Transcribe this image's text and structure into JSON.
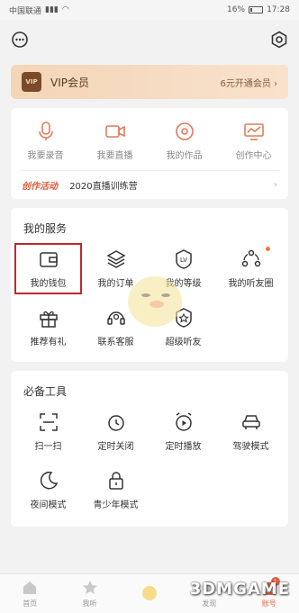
{
  "status_bar": {
    "carrier": "中国联通",
    "battery": "16%",
    "time": "17:28"
  },
  "vip": {
    "badge": "VIP",
    "label": "VIP会员",
    "action": "6元开通会员 ›"
  },
  "create": {
    "items": [
      {
        "label": "我要录音",
        "icon": "microphone-icon"
      },
      {
        "label": "我要直播",
        "icon": "video-camera-icon"
      },
      {
        "label": "我的作品",
        "icon": "disc-icon"
      },
      {
        "label": "创作中心",
        "icon": "chart-monitor-icon"
      }
    ],
    "activity_tag": "创作活动",
    "activity_text": "2020直播训练营",
    "activity_arrow": "›"
  },
  "services": {
    "title": "我的服务",
    "items": [
      {
        "label": "我的钱包",
        "icon": "wallet-icon"
      },
      {
        "label": "我的订单",
        "icon": "layers-icon"
      },
      {
        "label": "我的等级",
        "icon": "level-badge-icon"
      },
      {
        "label": "我的听友圈",
        "icon": "circle-people-icon"
      },
      {
        "label": "推荐有礼",
        "icon": "gift-icon"
      },
      {
        "label": "联系客服",
        "icon": "headset-icon"
      },
      {
        "label": "超级听友",
        "icon": "star-badge-icon"
      }
    ]
  },
  "tools": {
    "title": "必备工具",
    "items": [
      {
        "label": "扫一扫",
        "icon": "scan-icon"
      },
      {
        "label": "定时关闭",
        "icon": "clock-icon"
      },
      {
        "label": "定时播放",
        "icon": "alarm-play-icon"
      },
      {
        "label": "驾驶模式",
        "icon": "car-icon"
      },
      {
        "label": "夜间模式",
        "icon": "moon-icon"
      },
      {
        "label": "青少年模式",
        "icon": "lock-icon"
      }
    ]
  },
  "tabbar": {
    "items": [
      {
        "label": "首页"
      },
      {
        "label": "我听"
      },
      {
        "label": ""
      },
      {
        "label": "发现"
      },
      {
        "label": "账号"
      }
    ]
  },
  "watermark": "3DMGAME",
  "colors": {
    "accent": "#e05c3a",
    "vip_bg": "#f4d5b6",
    "highlight": "#c0282e"
  }
}
